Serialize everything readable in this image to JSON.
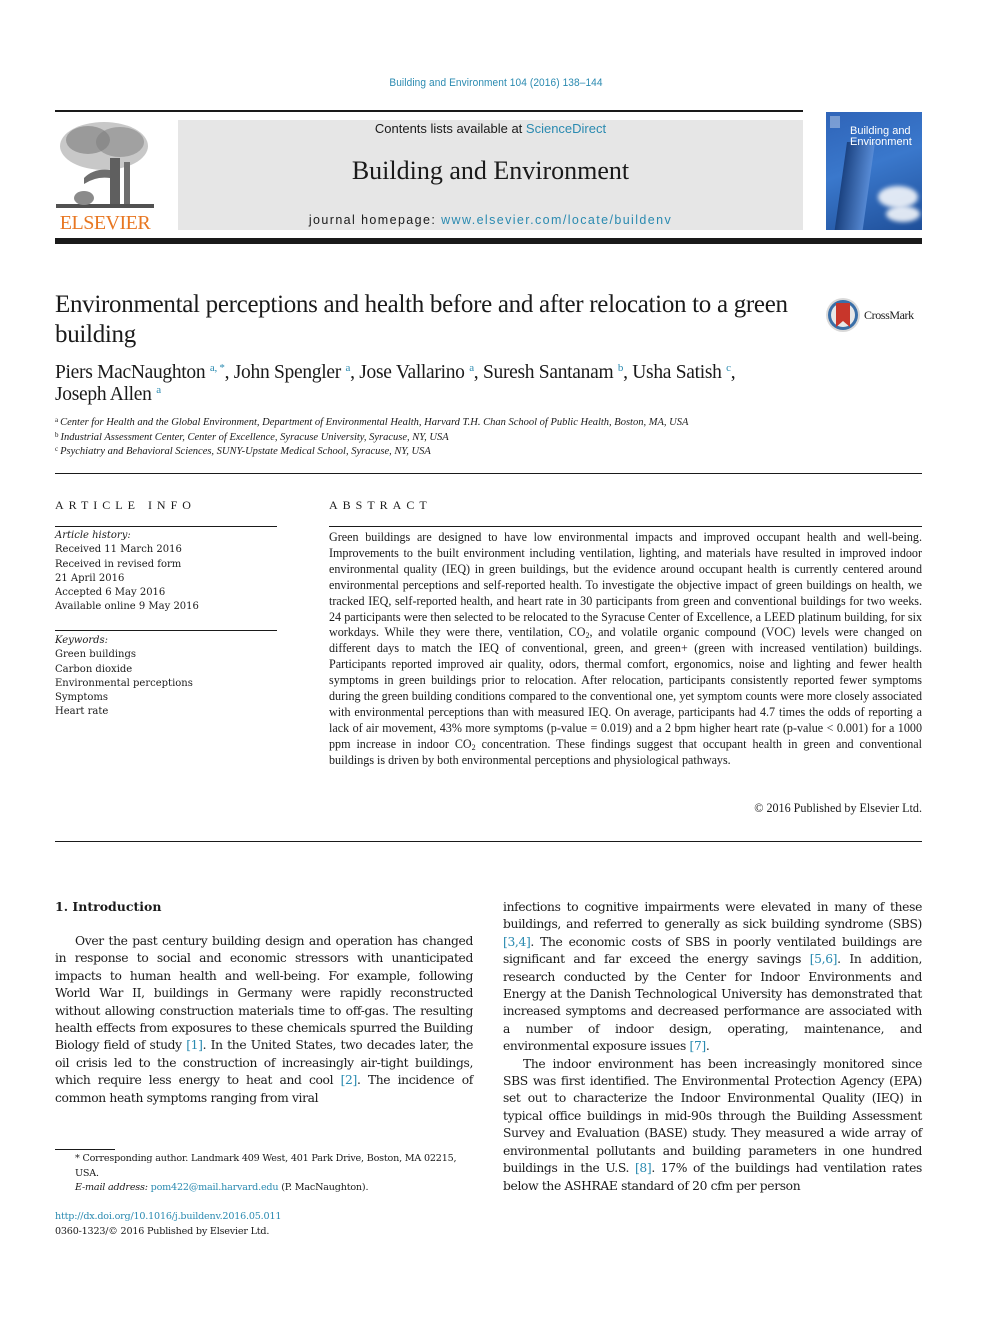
{
  "journal_citation": "Building and Environment 104 (2016) 138–144",
  "header": {
    "contents_prefix": "Contents lists available at ",
    "contents_link": "ScienceDirect",
    "journal_name": "Building and Environment",
    "homepage_prefix": "journal homepage: ",
    "homepage_url": "www.elsevier.com/locate/buildenv",
    "publisher_logo_text": "ELSEVIER",
    "cover_title": "Building and Environment"
  },
  "colors": {
    "link": "#2a8ab0",
    "elsevier_orange": "#e87722",
    "header_gray": "#e6e6e6"
  },
  "article": {
    "title": "Environmental perceptions and health before and after relocation to a green building",
    "crossmark_label": "CrossMark",
    "authors": [
      {
        "name": "Piers MacNaughton",
        "affil": "a, *",
        "sep": ", "
      },
      {
        "name": "John Spengler",
        "affil": "a",
        "sep": ", "
      },
      {
        "name": "Jose Vallarino",
        "affil": "a",
        "sep": ", "
      },
      {
        "name": "Suresh Santanam",
        "affil": "b",
        "sep": ", "
      },
      {
        "name": "Usha Satish",
        "affil": "c",
        "sep": ","
      },
      {
        "name": "Joseph Allen",
        "affil": "a",
        "sep": ""
      }
    ],
    "affiliations": [
      {
        "key": "a",
        "text": "Center for Health and the Global Environment, Department of Environmental Health, Harvard T.H. Chan School of Public Health, Boston, MA, USA"
      },
      {
        "key": "b",
        "text": "Industrial Assessment Center, Center of Excellence, Syracuse University, Syracuse, NY, USA"
      },
      {
        "key": "c",
        "text": "Psychiatry and Behavioral Sciences, SUNY-Upstate Medical School, Syracuse, NY, USA"
      }
    ]
  },
  "article_info": {
    "label": "ARTICLE INFO",
    "history_heading": "Article history:",
    "history": [
      "Received 11 March 2016",
      "Received in revised form",
      "21 April 2016",
      "Accepted 6 May 2016",
      "Available online 9 May 2016"
    ],
    "keywords_heading": "Keywords:",
    "keywords": [
      "Green buildings",
      "Carbon dioxide",
      "Environmental perceptions",
      "Symptoms",
      "Heart rate"
    ]
  },
  "abstract": {
    "label": "ABSTRACT",
    "part1": "Green buildings are designed to have low environmental impacts and improved occupant health and well-being. Improvements to the built environment including ventilation, lighting, and materials have resulted in improved indoor environmental quality (IEQ) in green buildings, but the evidence around occupant health is currently centered around environmental perceptions and self-reported health. To investigate the objective impact of green buildings on health, we tracked IEQ, self-reported health, and heart rate in 30 participants from green and conventional buildings for two weeks. 24 participants were then selected to be relocated to the Syracuse Center of Excellence, a LEED platinum building, for six workdays. While they were there, ventilation, CO",
    "sub1": "2",
    "part2": ", and volatile organic compound (VOC) levels were changed on different days to match the IEQ of conventional, green, and green+ (green with increased ventilation) buildings. Participants reported improved air quality, odors, thermal comfort, ergonomics, noise and lighting and fewer health symptoms in green buildings prior to relocation. After relocation, participants consistently reported fewer symptoms during the green building conditions compared to the conventional one, yet symptom counts were more closely associated with environmental perceptions than with measured IEQ. On average, participants had 4.7 times the odds of reporting a lack of air movement, 43% more symptoms (p-value = 0.019) and a 2 bpm higher heart rate (p-value < 0.001) for a 1000 ppm increase in indoor CO",
    "sub2": "2",
    "part3": " concentration. These findings suggest that occupant health in green and conventional buildings is driven by both environmental perceptions and physiological pathways.",
    "copyright": "© 2016 Published by Elsevier Ltd."
  },
  "body": {
    "intro_heading": "1.  Introduction",
    "left_p1_a": "Over the past century building design and operation has changed in response to social and economic stressors with unanticipated impacts to human health and well-being. For example, following World War II, buildings in Germany were rapidly reconstructed without allowing construction materials time to off-gas. The resulting health effects from exposures to these chemicals spurred the Building Biology field of study ",
    "ref1": "[1]",
    "left_p1_b": ". In the United States, two decades later, the oil crisis led to the construction of increasingly air-tight buildings, which require less energy to heat and cool ",
    "ref2": "[2]",
    "left_p1_c": ". The incidence of common heath symptoms ranging from viral",
    "right_p1_a": "infections to cognitive impairments were elevated in many of these buildings, and referred to generally as sick building syndrome (SBS) ",
    "ref34": "[3,4]",
    "right_p1_b": ". The economic costs of SBS in poorly ventilated buildings are significant and far exceed the energy savings ",
    "ref56": "[5,6]",
    "right_p1_c": ". In addition, research conducted by the Center for Indoor Environments and Energy at the Danish Technological University has demonstrated that increased symptoms and decreased performance are associated with a number of indoor design, operating, maintenance, and environmental exposure issues ",
    "ref7": "[7]",
    "right_p1_d": ".",
    "right_p2_a": "The indoor environment has been increasingly monitored since SBS was first identified. The Environmental Protection Agency (EPA) set out to characterize the Indoor Environmental Quality (IEQ) in typical office buildings in mid-90s through the Building Assessment Survey and Evaluation (BASE) study. They measured a wide array of environmental pollutants and building parameters in one hundred buildings in the U.S. ",
    "ref8": "[8]",
    "right_p2_b": ". 17% of the buildings had ventilation rates below the ASHRAE standard of 20 cfm per person"
  },
  "footnote": {
    "corresponding": "* Corresponding author. Landmark 409 West, 401 Park Drive, Boston, MA 02215, USA.",
    "email_label": "E-mail address: ",
    "email": "pom422@mail.harvard.edu",
    "email_suffix": " (P. MacNaughton).",
    "doi": "http://dx.doi.org/10.1016/j.buildenv.2016.05.011",
    "issn": "0360-1323/© 2016 Published by Elsevier Ltd."
  }
}
